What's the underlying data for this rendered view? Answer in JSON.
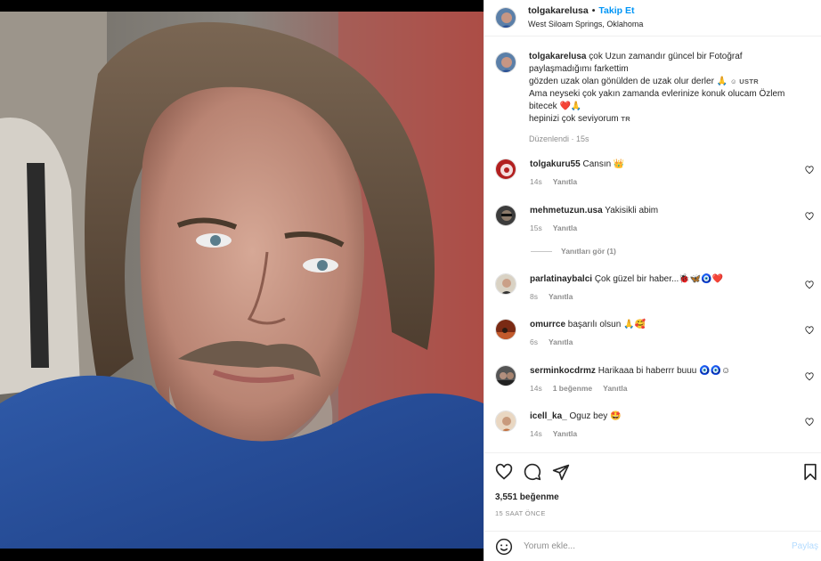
{
  "post": {
    "username": "tolgakarelusa",
    "follow_label": "Takip Et",
    "separator": "•",
    "location": "West Siloam Springs, Oklahoma"
  },
  "caption": {
    "username": "tolgakarelusa",
    "line1": "çok Uzun zamandır güncel bir Fotoğraf",
    "line2": "paylaşmadığımı farkettim",
    "line3": "gözden uzak olan gönülden de uzak olur derler",
    "line3_emoji": "🙏",
    "line3_tag": "☺ USTR",
    "line4": "Ama neyseki çok yakın zamanda evlerinize konuk olucam Özlem",
    "line5": "bitecek",
    "line5_emoji": "❤️🙏",
    "line6": "hepinizi çok seviyorum",
    "line6_tag": "TR",
    "edited_meta": "Düzenlendi · 15s"
  },
  "comments": [
    {
      "username": "tolgakuru55",
      "text": "Cansın 👑",
      "time": "14s",
      "reply_label": "Yanıtla",
      "likes_label": ""
    },
    {
      "username": "mehmetuzun.usa",
      "text": "Yakisikli abim",
      "time": "15s",
      "reply_label": "Yanıtla",
      "likes_label": ""
    },
    {
      "username": "parlatinaybalci",
      "text": "Çok güzel bir haber...🐞🦋🧿❤️",
      "time": "8s",
      "reply_label": "Yanıtla",
      "likes_label": ""
    },
    {
      "username": "omurrce",
      "text": "başarılı olsun 🙏🥰",
      "time": "6s",
      "reply_label": "Yanıtla",
      "likes_label": ""
    },
    {
      "username": "serminkocdrmz",
      "text": "Harikaaa bi haberrr buuu 🧿🧿☺",
      "time": "14s",
      "reply_label": "Yanıtla",
      "likes_label": "1 beğenme"
    },
    {
      "username": "icell_ka_",
      "text": "Oguz bey 🤩",
      "time": "14s",
      "reply_label": "Yanıtla",
      "likes_label": ""
    }
  ],
  "view_replies": "Yanıtları gör (1)",
  "likes": "3,551 beğenme",
  "time_ago": "15 SAAT ÖNCE",
  "comment_box": {
    "placeholder": "Yorum ekle...",
    "post_label": "Paylaş"
  },
  "colors": {
    "accent": "#0095f6",
    "muted": "#8e8e8e",
    "text": "#262626",
    "like_red": "#ed4956"
  },
  "icons": [
    "heart-icon",
    "comment-icon",
    "share-icon",
    "bookmark-icon",
    "emoji-icon",
    "small-heart-icon"
  ]
}
